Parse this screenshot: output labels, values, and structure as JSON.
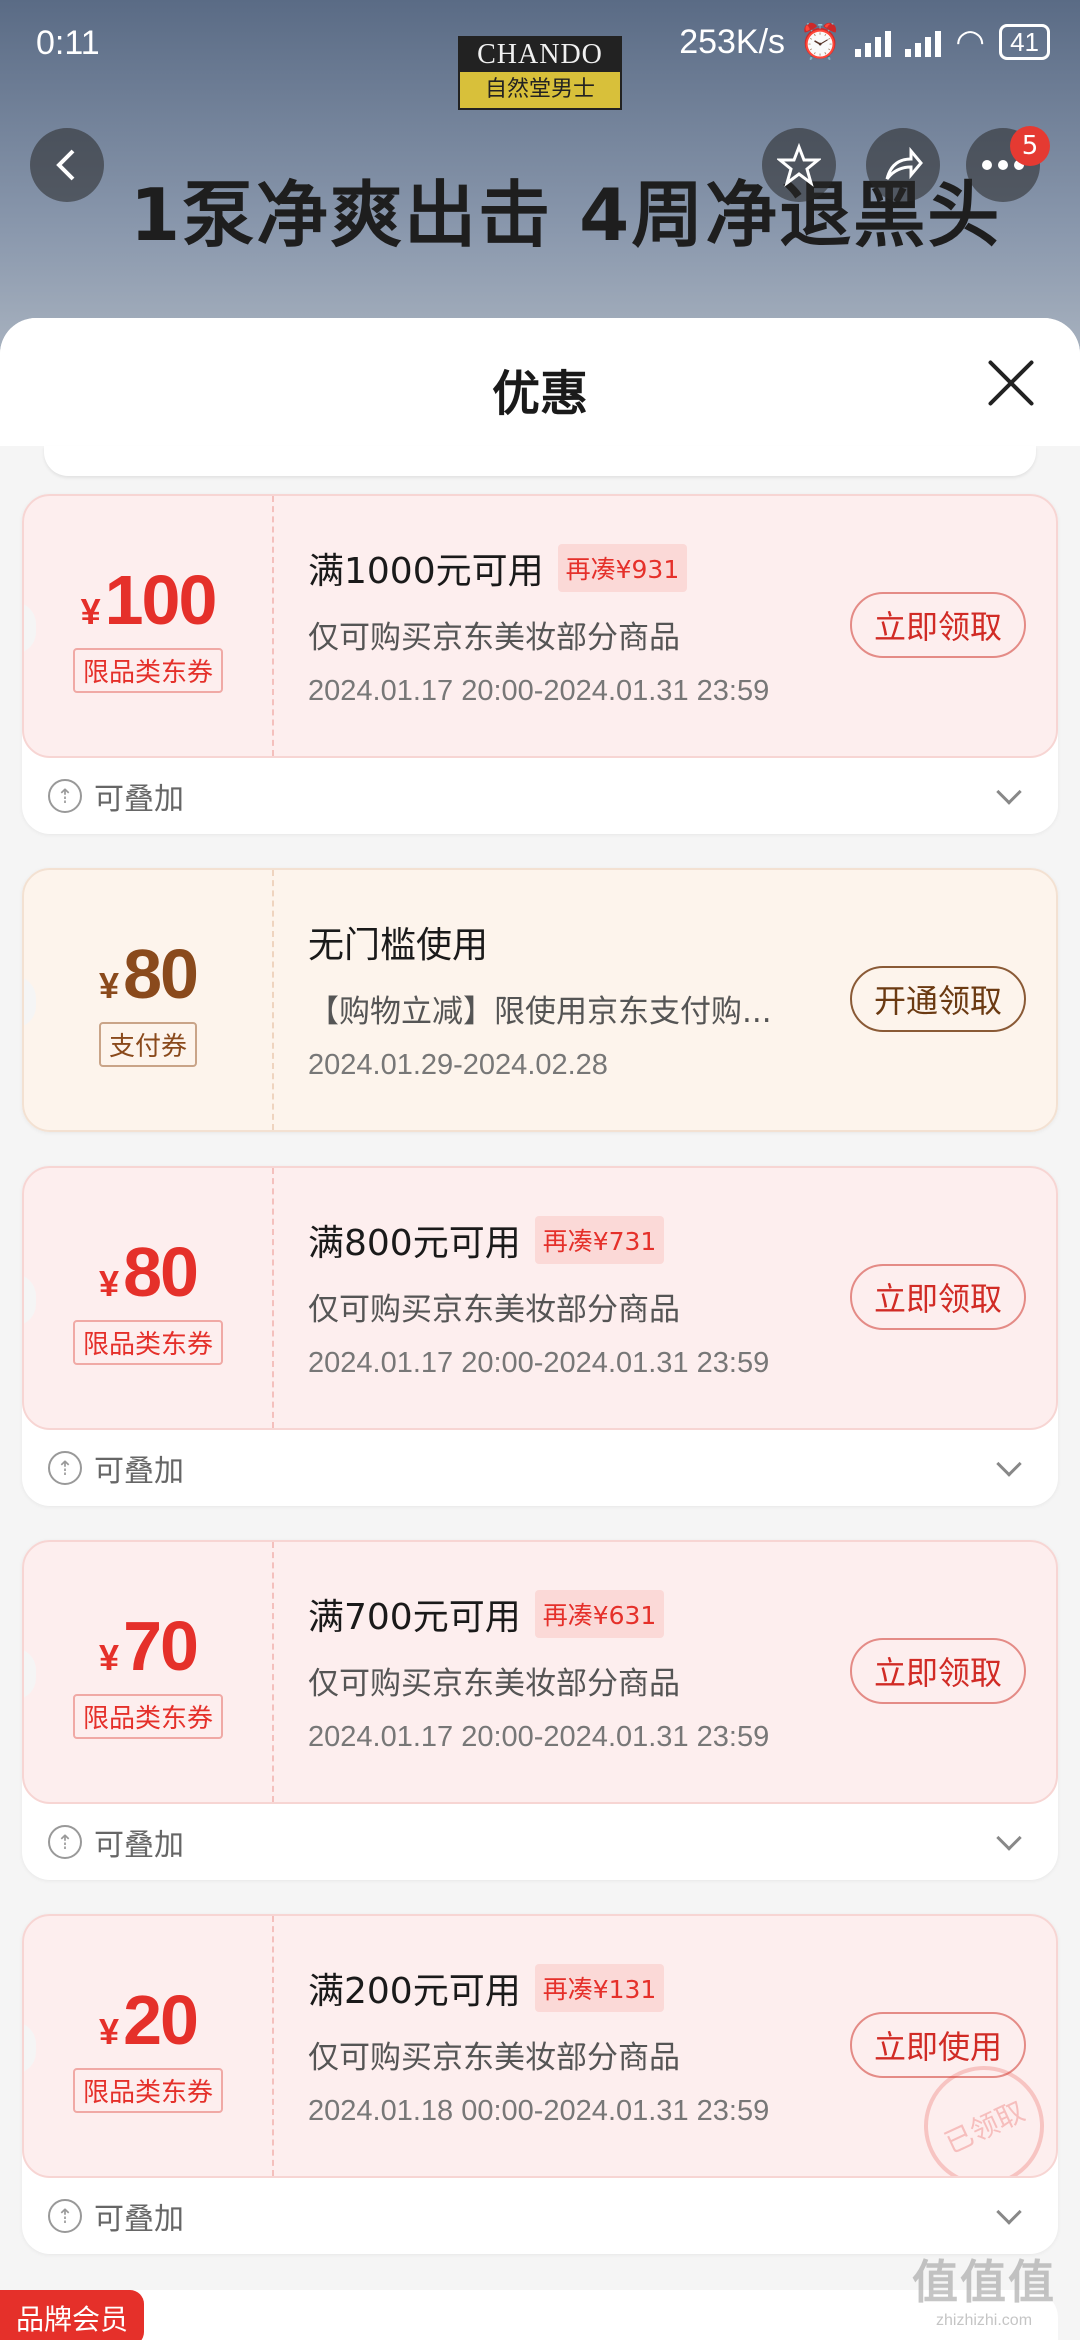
{
  "status_bar": {
    "time": "0:11",
    "speed": "253K/s",
    "battery": "41"
  },
  "background": {
    "brand_logo_top": "CHANDO",
    "brand_logo_bottom": "自然堂男士",
    "headline": "1泵净爽出击 4周净退黑头",
    "nav_badge": "5"
  },
  "sheet": {
    "title": "优惠"
  },
  "coupons": [
    {
      "style": "red",
      "yen": "¥",
      "amount": "100",
      "type": "限品类东券",
      "condition": "满1000元可用",
      "extra_tag": "再凑¥931",
      "desc": "仅可购买京东美妆部分商品",
      "date": "2024.01.17 20:00-2024.01.31 23:59",
      "button": "立即领取",
      "footer": "可叠加"
    },
    {
      "style": "brown",
      "yen": "¥",
      "amount": "80",
      "type": "支付券",
      "condition": "无门槛使用",
      "extra_tag": "",
      "desc": "【购物立减】限使用京东支付购...",
      "date": "2024.01.29-2024.02.28",
      "button": "开通领取",
      "footer": ""
    },
    {
      "style": "red",
      "yen": "¥",
      "amount": "80",
      "type": "限品类东券",
      "condition": "满800元可用",
      "extra_tag": "再凑¥731",
      "desc": "仅可购买京东美妆部分商品",
      "date": "2024.01.17 20:00-2024.01.31 23:59",
      "button": "立即领取",
      "footer": "可叠加"
    },
    {
      "style": "red",
      "yen": "¥",
      "amount": "70",
      "type": "限品类东券",
      "condition": "满700元可用",
      "extra_tag": "再凑¥631",
      "desc": "仅可购买京东美妆部分商品",
      "date": "2024.01.17 20:00-2024.01.31 23:59",
      "button": "立即领取",
      "footer": "可叠加"
    },
    {
      "style": "red",
      "yen": "¥",
      "amount": "20",
      "type": "限品类东券",
      "condition": "满200元可用",
      "extra_tag": "再凑¥131",
      "desc": "仅可购买京东美妆部分商品",
      "date": "2024.01.18 00:00-2024.01.31 23:59",
      "button": "立即使用",
      "footer": "可叠加",
      "stamp": "已领取"
    }
  ],
  "member_tag": "品牌会员",
  "watermark": {
    "line1": "值值值",
    "line2": "zhizhizhi.com"
  },
  "icons": {
    "back": "back-arrow-icon",
    "favorite": "star-icon",
    "share": "share-icon",
    "more": "more-icon",
    "close": "close-icon",
    "stack": "stack-icon",
    "expand": "chevron-down-icon"
  },
  "colors": {
    "accent_red": "#e5302a",
    "accent_brown": "#8a4a1c"
  }
}
